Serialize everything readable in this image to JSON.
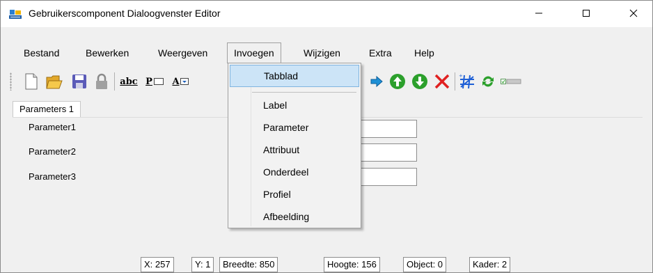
{
  "window": {
    "title": "Gebruikerscomponent Dialoogvenster Editor"
  },
  "menu": {
    "items": [
      {
        "label": "Bestand"
      },
      {
        "label": "Bewerken"
      },
      {
        "label": "Weergeven"
      },
      {
        "label": "Invoegen",
        "open": true
      },
      {
        "label": "Wijzigen"
      },
      {
        "label": "Extra"
      },
      {
        "label": "Help"
      }
    ]
  },
  "dropdown": {
    "items": [
      {
        "label": "Tabblad",
        "highlighted": true
      },
      {
        "label": "Label"
      },
      {
        "label": "Parameter"
      },
      {
        "label": "Attribuut"
      },
      {
        "label": "Onderdeel"
      },
      {
        "label": "Profiel"
      },
      {
        "label": "Afbeelding"
      }
    ]
  },
  "toolbar": {
    "icons": [
      "new-file-icon",
      "open-folder-icon",
      "save-icon",
      "lock-icon",
      "text-abc-icon",
      "parameter-icon",
      "attribute-icon",
      "arrow-right-icon",
      "move-up-icon",
      "move-down-icon",
      "delete-icon",
      "grid-icon",
      "refresh-icon",
      "toggle-icon"
    ],
    "text_abc": "abc",
    "text_p": "P",
    "text_a": "A"
  },
  "tab": {
    "label": "Parameters 1"
  },
  "parameters": [
    {
      "label": "Parameter1"
    },
    {
      "label": "Parameter2"
    },
    {
      "label": "Parameter3"
    }
  ],
  "status": {
    "x": "X: 257",
    "y": "Y: 1",
    "breedte": "Breedte: 850",
    "hoogte": "Hoogte: 156",
    "object": "Object: 0",
    "kader": "Kader: 2"
  },
  "colors": {
    "highlight": "#cce4f7",
    "highlight_border": "#7fb4e0",
    "arrow_blue": "#1e90d6",
    "green": "#2ca02c",
    "red": "#e02020"
  }
}
